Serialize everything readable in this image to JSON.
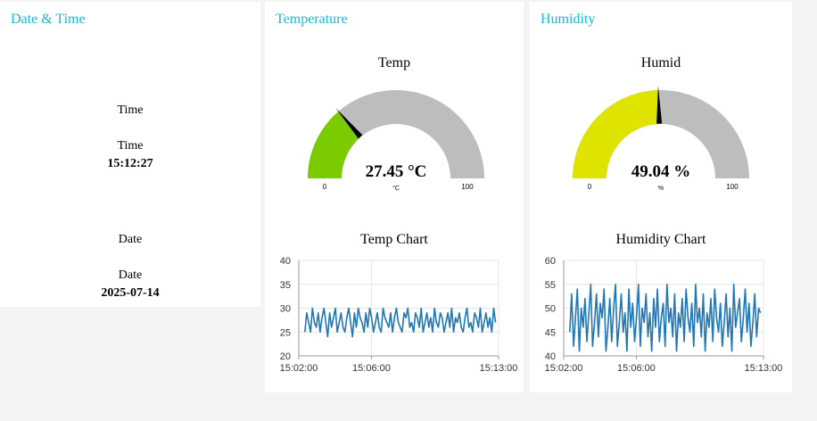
{
  "datetime": {
    "title": "Date & Time",
    "time_widget_label": "Time",
    "time_label": "Time",
    "time_value": "15:12:27",
    "date_widget_label": "Date",
    "date_label": "Date",
    "date_value": "2025-07-14"
  },
  "temperature": {
    "title": "Temperature",
    "gauge": {
      "title": "Temp",
      "value": 27.45,
      "value_text": "27.45 °C",
      "unit": "°C",
      "min": 0,
      "max": 100,
      "min_label": "0",
      "max_label": "100",
      "fill_color": "#7acc00",
      "track_color": "#bdbdbd"
    },
    "chart_title": "Temp Chart"
  },
  "humidity": {
    "title": "Humidity",
    "gauge": {
      "title": "Humid",
      "value": 49.04,
      "value_text": "49.04 %",
      "unit": "%",
      "min": 0,
      "max": 100,
      "min_label": "0",
      "max_label": "100",
      "fill_color": "#dfe300",
      "track_color": "#bdbdbd"
    },
    "chart_title": "Humidity Chart"
  },
  "chart_data": [
    {
      "type": "line",
      "title": "Temp Chart",
      "x_ticks": [
        "15:02:00",
        "15:06:00",
        "15:13:00"
      ],
      "y_ticks": [
        20,
        25,
        30,
        35,
        40
      ],
      "ylim": [
        20,
        40
      ],
      "xlim": [
        "15:02:00",
        "15:13:00"
      ],
      "grid": true,
      "line_color": "#1f77b4",
      "series": [
        {
          "x_start": "15:02:20",
          "x_end": "15:12:50",
          "values": [
            25,
            29,
            27,
            25,
            30,
            27,
            26,
            29,
            25,
            28,
            30,
            27,
            24,
            29,
            26,
            28,
            30,
            25,
            27,
            29,
            26,
            25,
            28,
            30,
            27,
            24,
            29,
            26,
            30,
            28,
            27,
            25,
            29,
            26,
            30,
            28,
            25,
            27,
            29,
            26,
            25,
            30,
            28,
            27,
            26,
            29,
            25,
            28,
            30,
            27,
            26,
            25,
            29,
            28,
            30,
            26,
            27,
            25,
            29,
            28,
            26,
            30,
            25,
            27,
            29,
            26,
            28,
            25,
            30,
            27,
            26,
            29,
            28,
            25,
            27,
            29,
            26,
            30,
            25,
            28,
            27,
            29,
            26,
            25,
            28,
            30,
            26,
            27,
            25,
            29,
            28,
            26,
            30,
            25,
            27,
            29,
            26,
            28,
            25,
            30,
            27
          ]
        }
      ]
    },
    {
      "type": "line",
      "title": "Humidity Chart",
      "x_ticks": [
        "15:02:00",
        "15:06:00",
        "15:13:00"
      ],
      "y_ticks": [
        40,
        45,
        50,
        55,
        60
      ],
      "ylim": [
        40,
        60
      ],
      "xlim": [
        "15:02:00",
        "15:13:00"
      ],
      "grid": true,
      "line_color": "#1f77b4",
      "series": [
        {
          "x_start": "15:02:20",
          "x_end": "15:12:50",
          "values": [
            45,
            53,
            42,
            48,
            54,
            41,
            50,
            46,
            52,
            43,
            49,
            55,
            42,
            47,
            53,
            44,
            51,
            48,
            54,
            41,
            46,
            52,
            43,
            50,
            55,
            42,
            47,
            53,
            45,
            49,
            41,
            54,
            46,
            51,
            43,
            48,
            55,
            42,
            50,
            47,
            53,
            44,
            49,
            41,
            52,
            46,
            54,
            43,
            48,
            51,
            42,
            55,
            47,
            50,
            44,
            53,
            41,
            49,
            46,
            52,
            43,
            54,
            48,
            45,
            51,
            42,
            55,
            47,
            50,
            44,
            53,
            41,
            49,
            46,
            52,
            43,
            54,
            48,
            45,
            51,
            42,
            47,
            53,
            44,
            50,
            41,
            55,
            46,
            49,
            52,
            43,
            48,
            54,
            45,
            51,
            42,
            47,
            53,
            44,
            50,
            49
          ]
        }
      ]
    }
  ]
}
